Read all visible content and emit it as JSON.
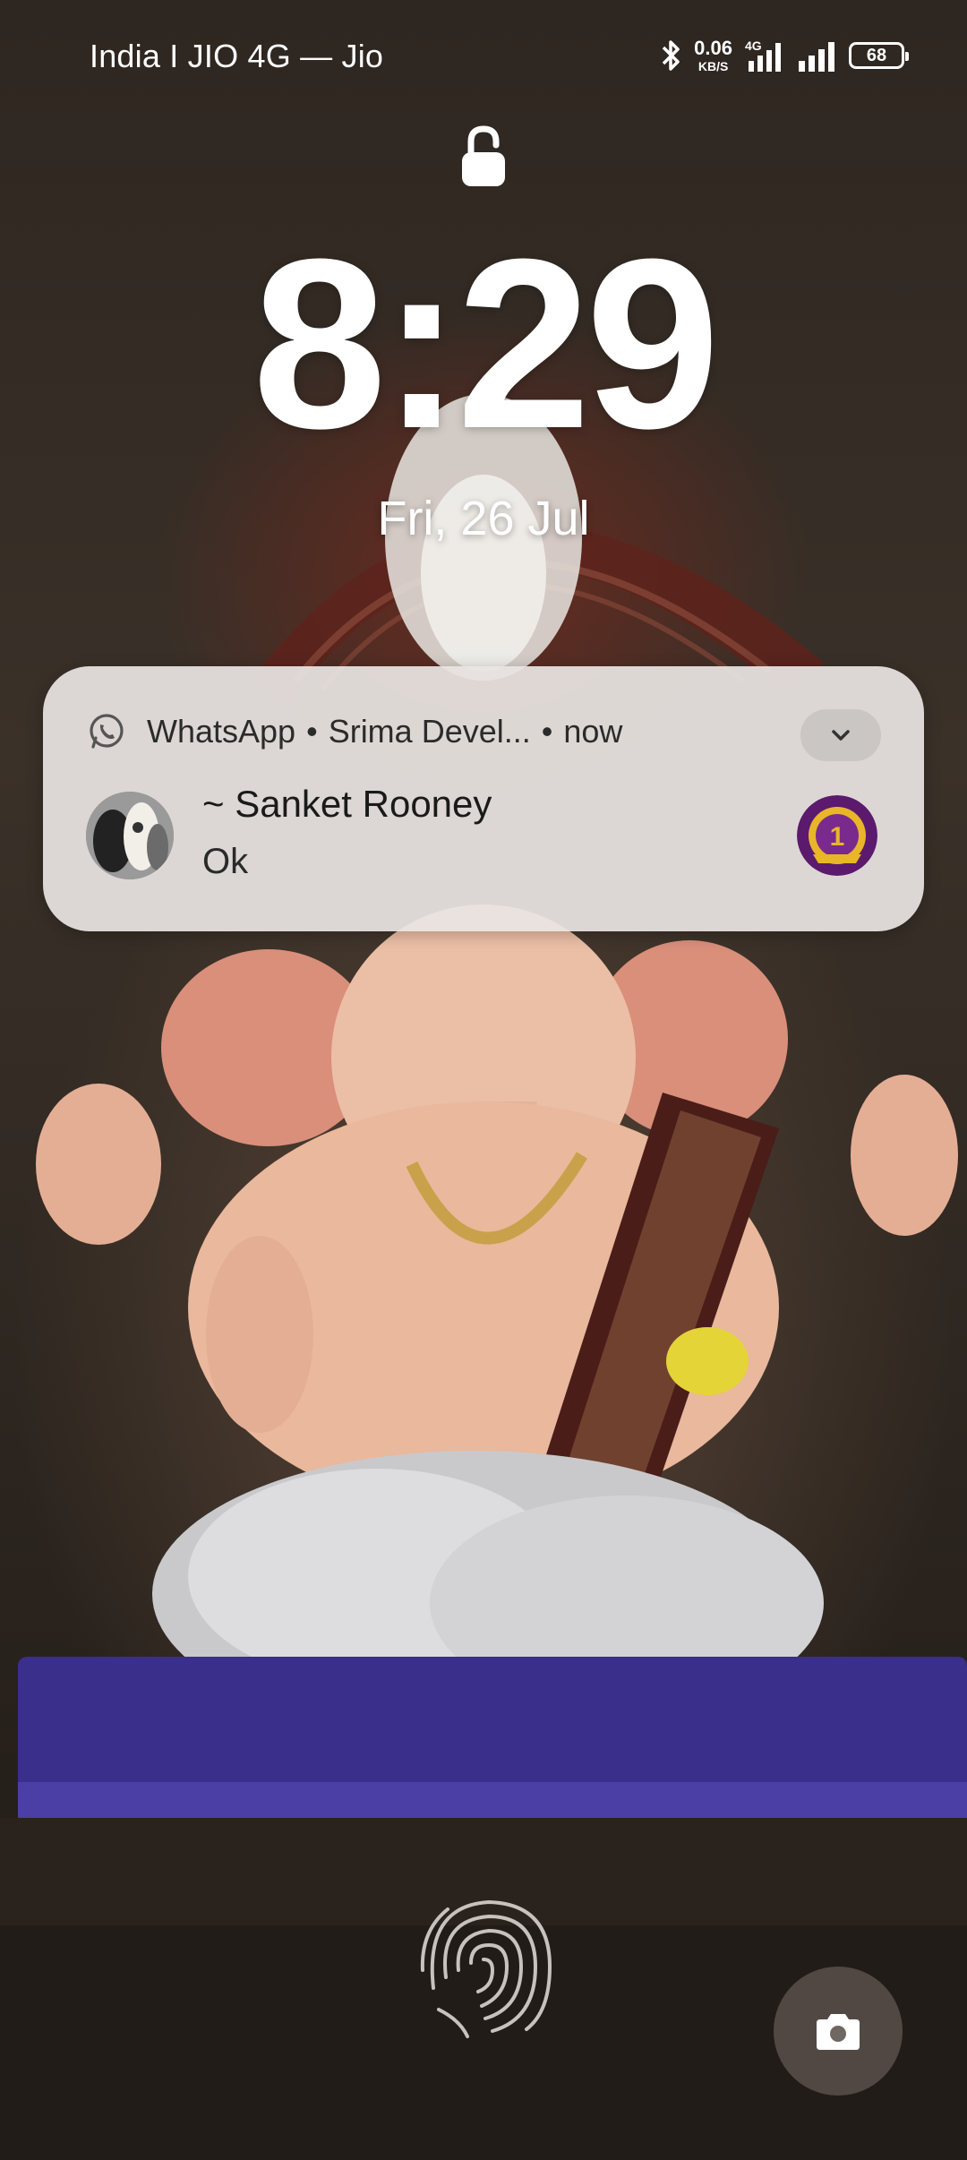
{
  "status_bar": {
    "carrier": "India I JIO 4G — Jio",
    "net_speed_value": "0.06",
    "net_speed_unit": "KB/S",
    "network_type": "4G",
    "battery_level": "68",
    "icons": [
      "bluetooth-icon",
      "signal-4g-icon",
      "signal-icon",
      "battery-icon"
    ]
  },
  "lockscreen": {
    "lock_icon": "lock-open-icon",
    "time": "8:29",
    "date": "Fri, 26 Jul"
  },
  "notification": {
    "app_icon": "whatsapp-icon",
    "app_name": "WhatsApp",
    "separator": "•",
    "group": "Srima Devel...",
    "time": "now",
    "expand_icon": "chevron-down-icon",
    "sender": "~ Sanket Rooney",
    "message": "Ok",
    "badge_text": "1"
  },
  "bottom": {
    "fingerprint_icon": "fingerprint-icon",
    "camera_icon": "camera-icon"
  },
  "colors": {
    "card_bg": "#E8E4E2",
    "text_white": "#FFFFFF",
    "badge_purple": "#5B1A6E",
    "badge_gold": "#E8B628"
  }
}
